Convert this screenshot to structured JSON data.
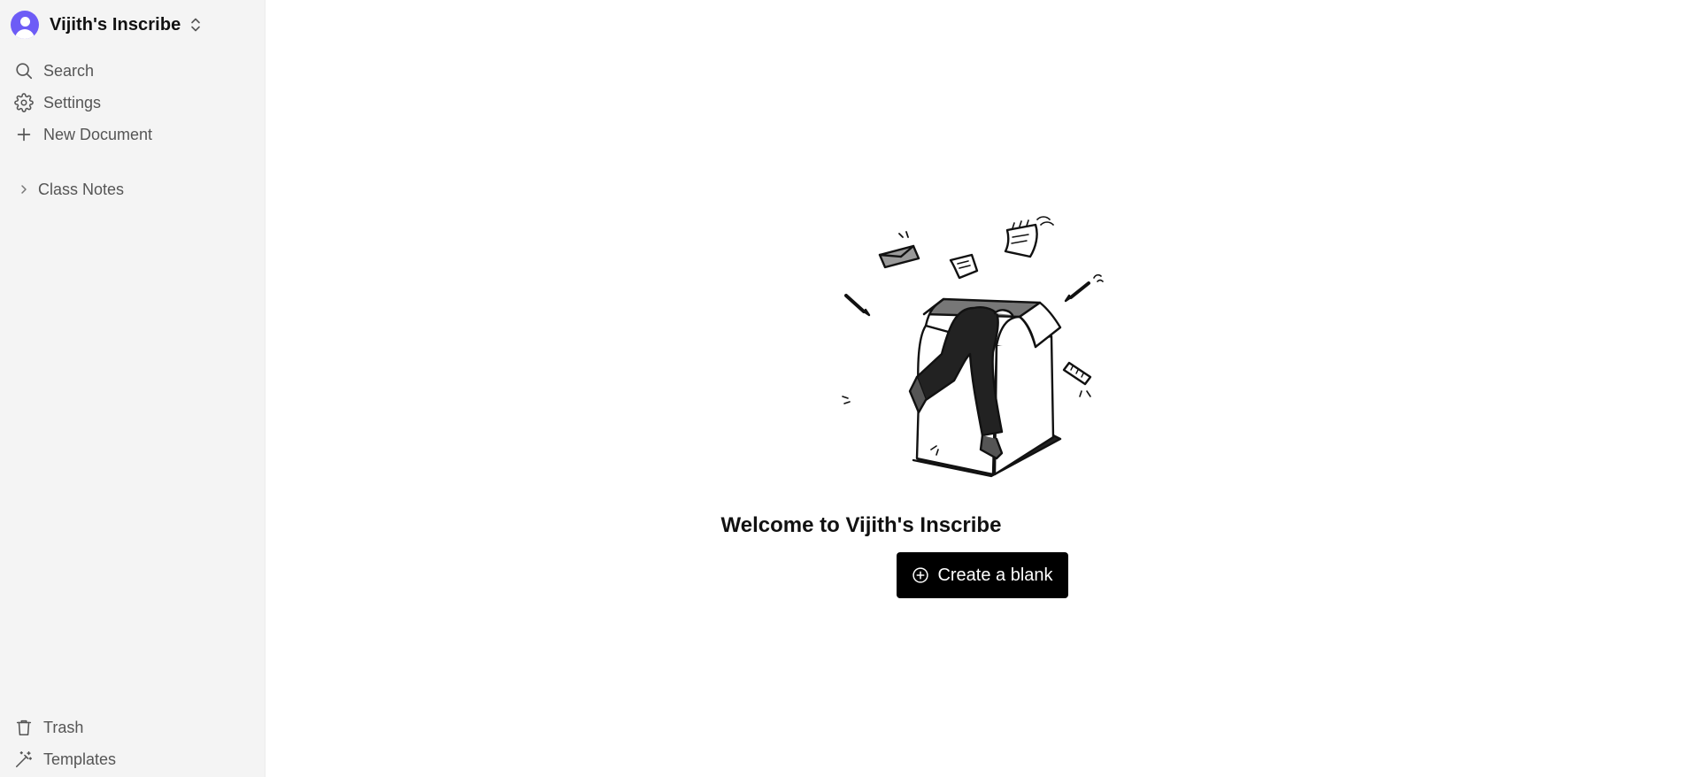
{
  "sidebar": {
    "workspace": {
      "name": "Vijith's Inscribe",
      "avatar_color": "#6d5cf6"
    },
    "nav_items": [
      {
        "label": "Search",
        "icon": "search-icon"
      },
      {
        "label": "Settings",
        "icon": "gear-icon"
      },
      {
        "label": "New Document",
        "icon": "plus-icon"
      }
    ],
    "tree": [
      {
        "label": "Class Notes",
        "icon": "chevron-right-icon"
      }
    ],
    "bottom_items": [
      {
        "label": "Trash",
        "icon": "trash-icon"
      },
      {
        "label": "Templates",
        "icon": "magic-wand-icon"
      }
    ]
  },
  "main": {
    "welcome_title": "Welcome to Vijith's Inscribe",
    "create_button_label": "Create a blank",
    "create_button_icon": "plus-circle-icon",
    "illustration": "person-diving-into-box-illustration"
  },
  "colors": {
    "sidebar_bg": "#f4f4f4",
    "primary_button_bg": "#000000",
    "primary_button_text": "#ffffff",
    "accent": "#6d5cf6"
  }
}
